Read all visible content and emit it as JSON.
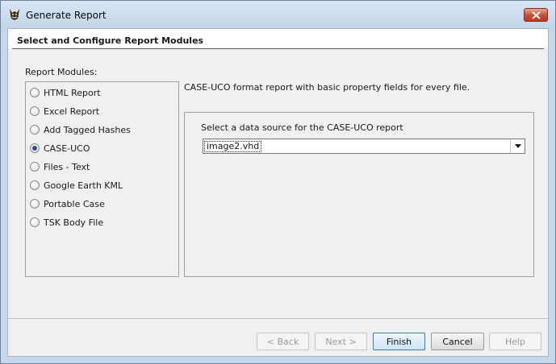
{
  "window": {
    "title": "Generate Report"
  },
  "header": {
    "title": "Select and Configure Report Modules"
  },
  "modules": {
    "label": "Report Modules:",
    "items": [
      {
        "label": "HTML Report",
        "selected": false
      },
      {
        "label": "Excel Report",
        "selected": false
      },
      {
        "label": "Add Tagged Hashes",
        "selected": false
      },
      {
        "label": "CASE-UCO",
        "selected": true
      },
      {
        "label": "Files - Text",
        "selected": false
      },
      {
        "label": "Google Earth KML",
        "selected": false
      },
      {
        "label": "Portable Case",
        "selected": false
      },
      {
        "label": "TSK Body File",
        "selected": false
      }
    ]
  },
  "config": {
    "description": "CASE-UCO format report with basic property fields for every file.",
    "datasource_label": "Select a data source for the CASE-UCO report",
    "datasource_value": "image2.vhd"
  },
  "buttons": {
    "back": "< Back",
    "next": "Next >",
    "finish": "Finish",
    "cancel": "Cancel",
    "help": "Help"
  },
  "colors": {
    "selected_radio": "#324c8a",
    "close_button": "#c74d33",
    "title_bar": "#c5d7ea"
  }
}
